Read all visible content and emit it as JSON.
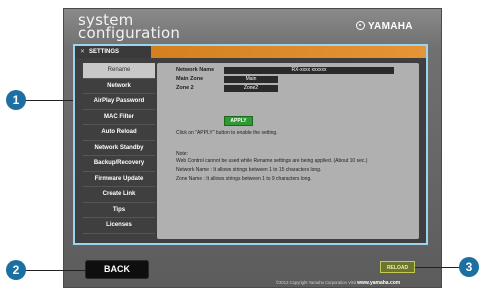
{
  "header": {
    "app_title_line1": "system",
    "app_title_line2": "configuration",
    "brand": "YAMAHA"
  },
  "settings_tab": {
    "close_glyph": "✕",
    "label": "SETTINGS"
  },
  "sidebar": {
    "items": [
      {
        "label": "Rename",
        "active": true
      },
      {
        "label": "Network"
      },
      {
        "label": "AirPlay Password"
      },
      {
        "label": "MAC Filter"
      },
      {
        "label": "Auto Reload"
      },
      {
        "label": "Network Standby"
      },
      {
        "label": "Backup/Recovery"
      },
      {
        "label": "Firmware Update"
      },
      {
        "label": "Create Link"
      },
      {
        "label": "Tips"
      },
      {
        "label": "Licenses"
      }
    ]
  },
  "form": {
    "network_name_label": "Network Name",
    "network_name_value": "RX-xxxx xxxxxx",
    "main_zone_label": "Main Zone",
    "main_zone_value": "Main",
    "zone2_label": "Zone 2",
    "zone2_value": "Zone2",
    "apply_label": "APPLY"
  },
  "messages": {
    "instruction": "Click on \"APPLY\" button to enable the setting.",
    "note_heading": "Note:",
    "note1": "Web Control cannot be used while Rename settings are being applied. (About 10 sec.)",
    "note2": "Network Name : It allows strings between 1 to 15 characters long.",
    "note3": "Zone Name : It allows strings between 1 to 9 characters long."
  },
  "footer": {
    "back_label": "BACK",
    "reload_label": "RELOAD",
    "copyright": "©2013 Copyright Yamaha Corporation Visit",
    "site": "www.yamaha.com"
  },
  "callouts": {
    "c1": "1",
    "c2": "2",
    "c3": "3"
  },
  "colors": {
    "accent_orange": "#e59436",
    "panel_border": "#9bd3f0",
    "apply_green": "#2f9a33",
    "callout_blue": "#1c6fa0"
  }
}
